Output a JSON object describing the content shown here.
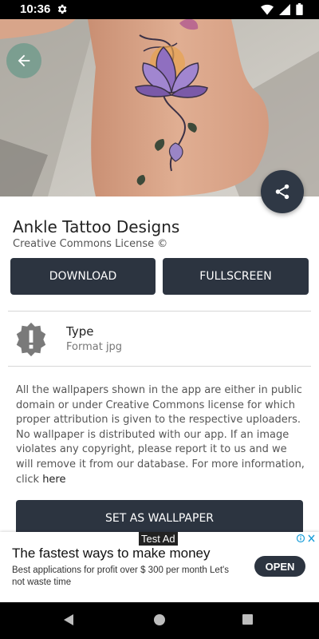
{
  "status_bar": {
    "time": "10:36",
    "icons": [
      "gear-icon",
      "wifi-icon",
      "signal-icon",
      "battery-icon"
    ]
  },
  "hero": {
    "image_subject": "lotus flower ankle tattoo photo",
    "back_icon": "arrow-left-icon",
    "share_icon": "share-icon"
  },
  "header": {
    "title": "Ankle Tattoo Designs",
    "license": "Creative Commons License ©"
  },
  "actions": {
    "download_label": "DOWNLOAD",
    "fullscreen_label": "FULLSCREEN",
    "set_wallpaper_label": "SET AS WALLPAPER"
  },
  "info": {
    "icon": "alert-badge-icon",
    "label": "Type",
    "value": "Format jpg"
  },
  "description": {
    "text": "All the wallpapers shown in the app are either in public domain or under Creative Commons license for which proper attribution is given to the respective uploaders. No wallpaper is distributed with our app. If an image violates any copyright, please report it to us and we will remove it from our database. For more information, click ",
    "link_text": "here"
  },
  "ad": {
    "tag": "Test Ad",
    "headline": "The fastest ways to make money",
    "body": "Best applications for profit over $ 300 per month Let's not waste time",
    "cta": "OPEN",
    "choices_icons": [
      "ad-info-icon",
      "ad-close-icon"
    ]
  },
  "colors": {
    "primary_dark": "#2c3440",
    "fab": "#2f3845",
    "background": "#ffffff"
  }
}
